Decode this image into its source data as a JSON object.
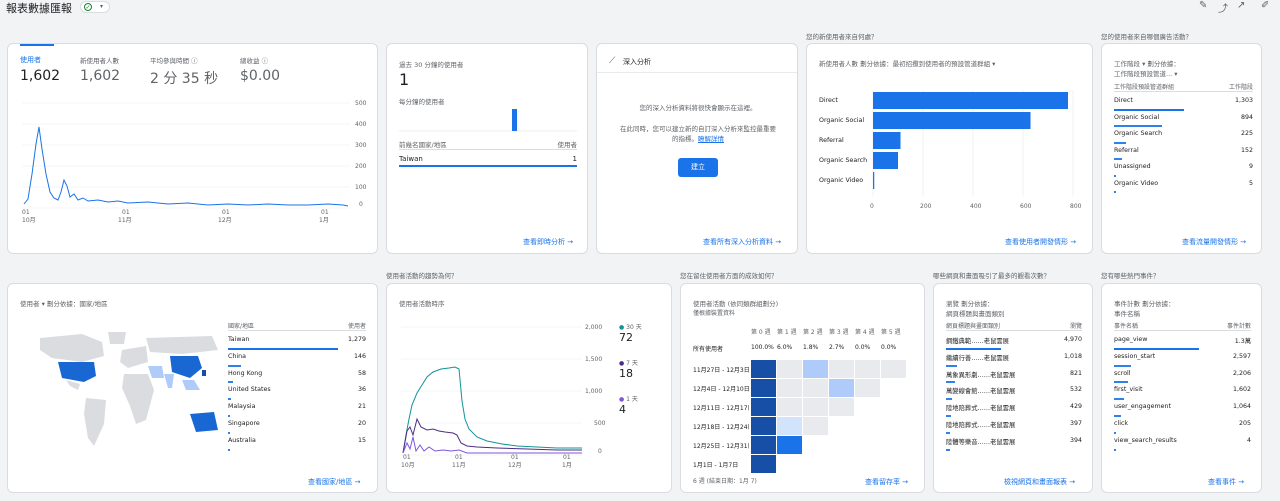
{
  "header": {
    "title": "報表數據匯報"
  },
  "overview": {
    "metrics": [
      {
        "label": "使用者",
        "value": "1,602"
      },
      {
        "label": "新使用者人數",
        "value": "1,602"
      },
      {
        "label": "平均參與時間",
        "value": "2 分 35 秒"
      },
      {
        "label": "總收益",
        "value": "$0.00"
      }
    ],
    "y_ticks": [
      "500",
      "400",
      "300",
      "200",
      "100",
      "0"
    ],
    "x_ticks": [
      {
        "d": "01",
        "m": "10月"
      },
      {
        "d": "01",
        "m": "11月"
      },
      {
        "d": "01",
        "m": "12月"
      },
      {
        "d": "01",
        "m": "1月"
      }
    ]
  },
  "realtime": {
    "title": "過去 30 分鐘的使用者",
    "value": "1",
    "sub": "每分鐘的使用者",
    "col1": "前幾名國家/地區",
    "col2": "使用者",
    "rows": [
      {
        "name": "Taiwan",
        "value": "1"
      }
    ],
    "link": "查看即時分析"
  },
  "insights": {
    "title": "深入分析",
    "msg1": "您的深入分析資料將很快會顯示在這裡。",
    "msg2a": "在此同時，您可以建立新的自訂深入分析來監控最重要",
    "msg2b": "的指標。",
    "msg2link": "瞭解詳情",
    "button": "建立",
    "link": "查看所有深入分析資料"
  },
  "acquisition": {
    "question": "您的新使用者來自何處？",
    "subtitle": "新使用者人數 劃分依據：最初招攬到使用者的預設管道群組",
    "categories": [
      "Direct",
      "Organic Social",
      "Referral",
      "Organic Search",
      "Organic Video"
    ],
    "values": [
      780,
      630,
      110,
      100,
      5
    ],
    "x_ticks": [
      "0",
      "200",
      "400",
      "600",
      "800"
    ],
    "link": "查看使用者開發情形"
  },
  "traffic": {
    "question": "您的使用者來自哪個廣告活動？",
    "subtitle1": "工作階段 ▾ 劃分依據：",
    "subtitle2": "工作階段預設管道... ▾",
    "col1": "工作階段預設管道群組",
    "col2": "工作階段",
    "rows": [
      {
        "name": "Direct",
        "value": "1,303"
      },
      {
        "name": "Organic Social",
        "value": "894"
      },
      {
        "name": "Organic Search",
        "value": "225"
      },
      {
        "name": "Referral",
        "value": "152"
      },
      {
        "name": "Unassigned",
        "value": "9"
      },
      {
        "name": "Organic Video",
        "value": "5"
      }
    ],
    "link": "查看流量開發情形"
  },
  "country": {
    "subtitle": "使用者 ▾ 劃分依據：國家/地區",
    "col1": "國家/地區",
    "col2": "使用者",
    "rows": [
      {
        "name": "Taiwan",
        "value": "1,279"
      },
      {
        "name": "China",
        "value": "146"
      },
      {
        "name": "Hong Kong",
        "value": "58"
      },
      {
        "name": "United States",
        "value": "36"
      },
      {
        "name": "Malaysia",
        "value": "21"
      },
      {
        "name": "Singapore",
        "value": "20"
      },
      {
        "name": "Australia",
        "value": "15"
      }
    ],
    "link": "查看國家/地區"
  },
  "activity": {
    "question": "使用者活動的趨勢為何？",
    "title": "使用者活動時序",
    "y_ticks": [
      "2,000",
      "1,500",
      "1,000",
      "500",
      "0"
    ],
    "x_ticks": [
      {
        "d": "01",
        "m": "10月"
      },
      {
        "d": "01",
        "m": "11月"
      },
      {
        "d": "01",
        "m": "12月"
      },
      {
        "d": "01",
        "m": "1月"
      }
    ],
    "legend": [
      {
        "label": "30 天",
        "value": "72"
      },
      {
        "label": "7 天",
        "value": "18"
      },
      {
        "label": "1 天",
        "value": "4"
      }
    ]
  },
  "retention": {
    "question": "您在留住使用者方面的成效如何？",
    "title": "使用者活動 (依同類群組劃分)",
    "subtitle": "僅根據裝置資料",
    "weeks": [
      "第 0 週",
      "第 1 週",
      "第 2 週",
      "第 3 週",
      "第 4 週",
      "第 5 週"
    ],
    "all_label": "所有使用者",
    "all_values": [
      "100.0%",
      "6.0%",
      "1.8%",
      "2.7%",
      "0.0%",
      "0.0%"
    ],
    "rows": [
      "11月27日 - 12月3日",
      "12月4日 - 12月10日",
      "12月11日 - 12月17日",
      "12月18日 - 12月24日",
      "12月25日 - 12月31日",
      "1月1日 - 1月7日"
    ],
    "footer": "6 週 (結束日期：1月 7)",
    "link": "查看留存率"
  },
  "pages": {
    "question": "哪些網頁和畫面吸引了最多的觀看次數？",
    "subtitle1": "瀏覽 劃分依據：",
    "subtitle2": "網頁標題與畫面類別",
    "col1": "網頁標題與畫面類別",
    "col2": "瀏覽",
    "rows": [
      {
        "name": "鋼鐵典範……老鼠雲展",
        "value": "4,970"
      },
      {
        "name": "繼續行善……老鼠雲展",
        "value": "1,018"
      },
      {
        "name": "萬象異形劇……老鼠雲展",
        "value": "821"
      },
      {
        "name": "萬變線會館……老鼠雲展",
        "value": "532"
      },
      {
        "name": "陸地陪葬式……老鼠雲展",
        "value": "429"
      },
      {
        "name": "陸地陪葬式……老鼠雲展",
        "value": "397"
      },
      {
        "name": "陸體等樂音……老鼠雲展",
        "value": "394"
      }
    ],
    "link": "檢視網頁和畫面報表"
  },
  "events": {
    "question": "您有哪些熱門事件？",
    "subtitle1": "事件計數 劃分依據：",
    "subtitle2": "事件名稱",
    "col1": "事件名稱",
    "col2": "事件計數",
    "rows": [
      {
        "name": "page_view",
        "value": "1.3萬"
      },
      {
        "name": "session_start",
        "value": "2,597"
      },
      {
        "name": "scroll",
        "value": "2,206"
      },
      {
        "name": "first_visit",
        "value": "1,602"
      },
      {
        "name": "user_engagement",
        "value": "1,064"
      },
      {
        "name": "click",
        "value": "205"
      },
      {
        "name": "view_search_results",
        "value": "4"
      }
    ],
    "link": "查看事件"
  },
  "colors": {
    "accent": "#1a73e8",
    "dark": "#174ea6",
    "light": "#aecbfa"
  }
}
